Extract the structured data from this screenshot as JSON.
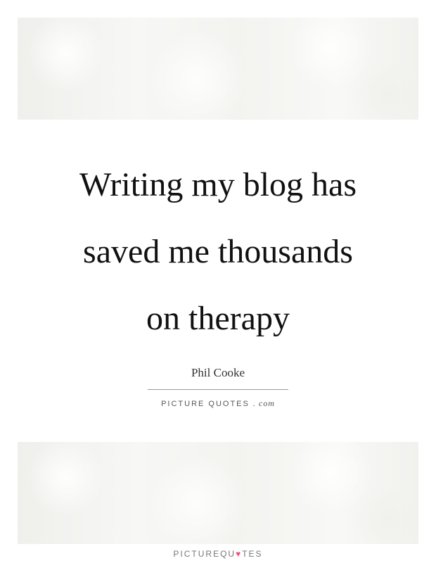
{
  "quote": {
    "lines": [
      "Writing my blog has",
      "saved me thousands",
      "on therapy"
    ],
    "author": "Phil Cooke"
  },
  "watermark": {
    "site": "PICTURE QUOTES",
    "dotcom": ". com"
  },
  "footer": {
    "logo_prefix": "PICTUREQU",
    "logo_heart": "♥",
    "logo_suffix": "TES"
  },
  "colors": {
    "text": "#111111",
    "heart": "#e8587a",
    "rule": "#999999"
  }
}
